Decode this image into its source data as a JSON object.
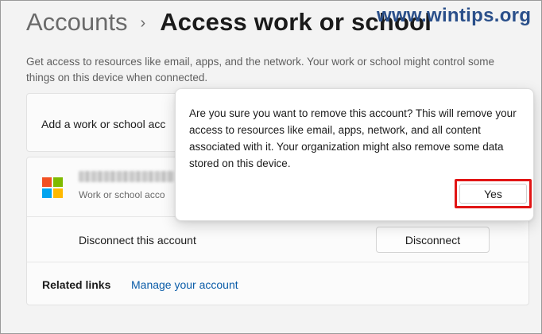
{
  "header": {
    "breadcrumb_parent": "Accounts",
    "separator": "›",
    "breadcrumb_current": "Access work or school"
  },
  "watermark": "www.wintips.org",
  "description": "Get access to resources like email, apps, and the network. Your work or school might control some things on this device when connected.",
  "add_account": {
    "label": "Add a work or school acc"
  },
  "account": {
    "type_label": "Work or school acco",
    "disconnect_label": "Disconnect this account",
    "disconnect_button": "Disconnect"
  },
  "related": {
    "label": "Related links",
    "manage_link": "Manage your account"
  },
  "dialog": {
    "message": "Are you sure you want to remove this account? This will remove your access to resources like email, apps, network, and all content associated with it. Your organization might also remove some data stored on this device.",
    "yes_button": "Yes"
  },
  "colors": {
    "accent_link": "#0a5ca8",
    "highlight_border": "#e11515",
    "ms_red": "#f25022",
    "ms_green": "#7fba00",
    "ms_blue": "#00a4ef",
    "ms_yellow": "#ffb900"
  },
  "icons": {
    "breadcrumb_separator": "chevron-right-icon",
    "account_logo": "microsoft-logo-icon"
  }
}
